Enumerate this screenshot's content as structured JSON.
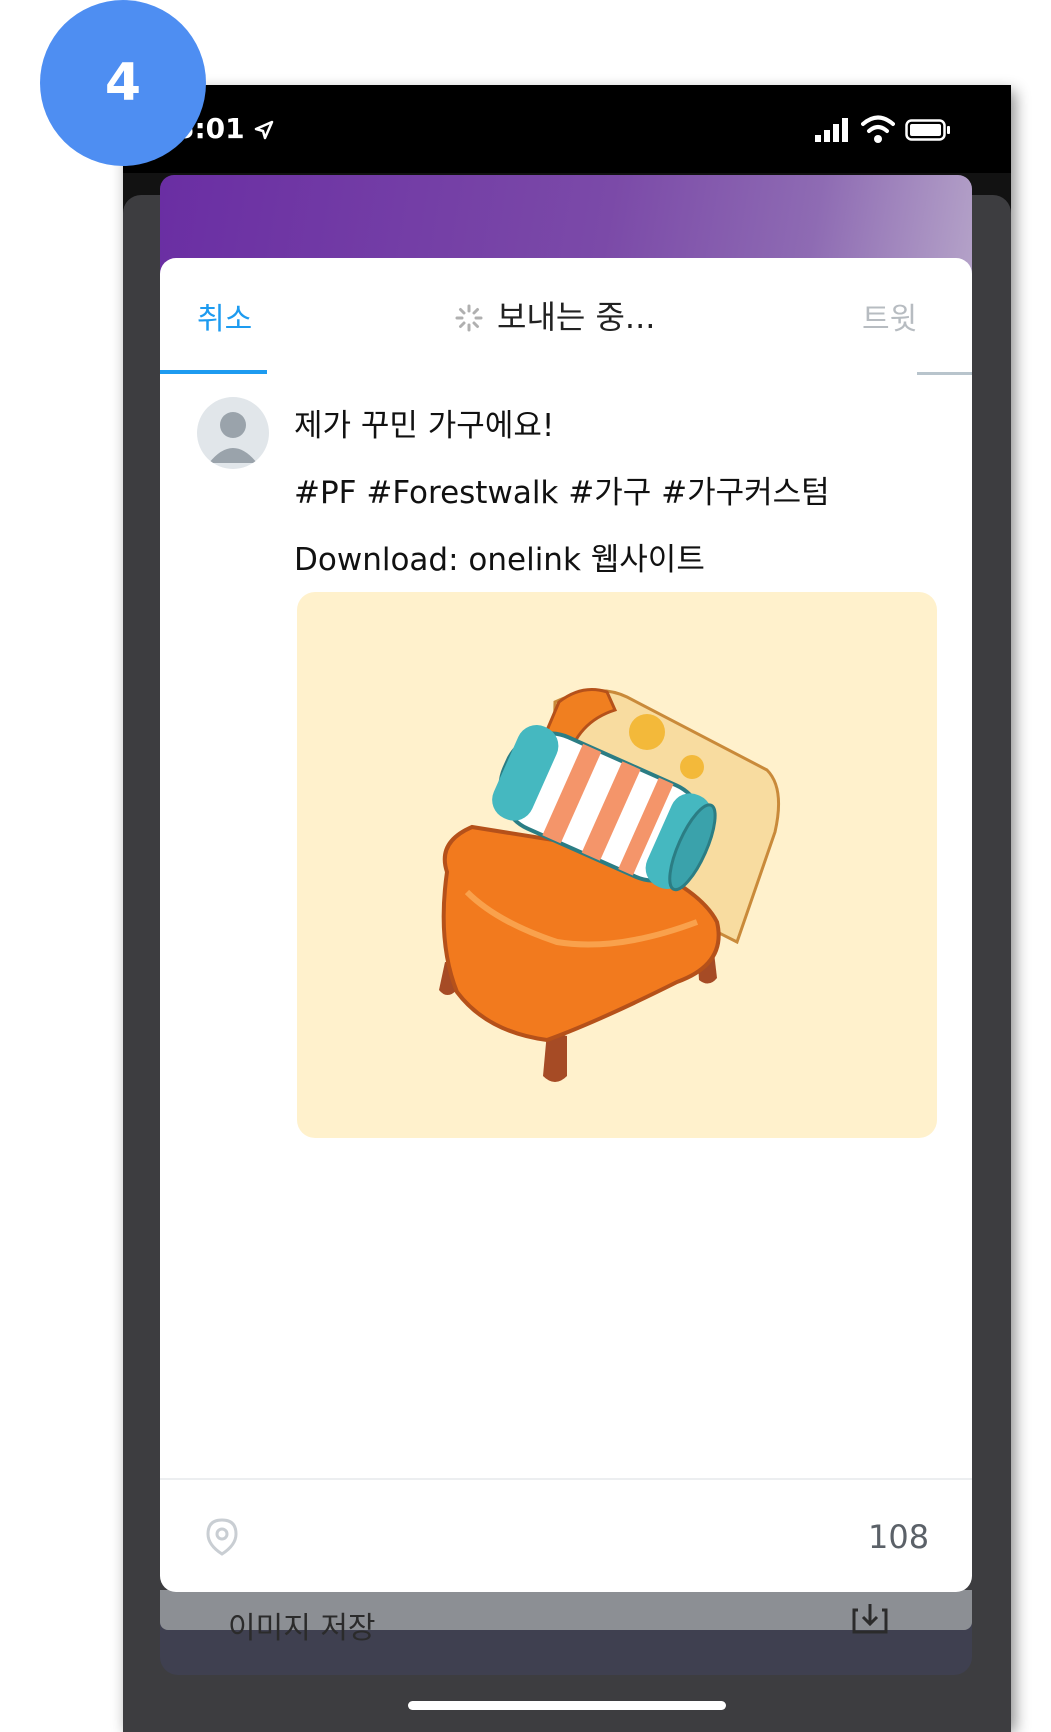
{
  "step_badge": "4",
  "status_bar": {
    "time": "5:01",
    "icons": [
      "location-arrow-icon",
      "signal-icon",
      "wifi-icon",
      "battery-icon"
    ]
  },
  "compose": {
    "cancel_label": "취소",
    "status_label": "보내는 중...",
    "tweet_label": "트윗",
    "text_lines": [
      "제가 꾸민 가구에요!",
      "#PF #Forestwalk #가구 #가구커스텀",
      "Download: onelink 웹사이트"
    ],
    "attached_image": "armchair-with-striped-cushion",
    "char_count": "108"
  },
  "share_sheet": {
    "save_image_label": "이미지 저장"
  },
  "colors": {
    "accent": "#1d9bf0",
    "badge": "#4e8ef2",
    "image_bg": "#fff1cc"
  }
}
